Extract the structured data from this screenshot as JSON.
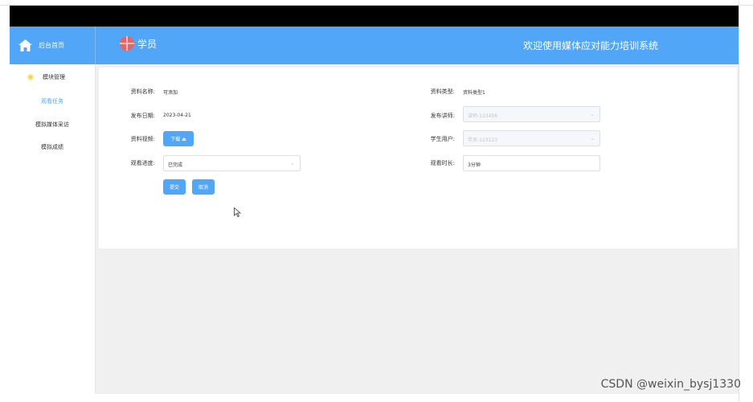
{
  "header": {
    "home_label": "后台首页",
    "role_label": "学员",
    "welcome_text": "欢迎使用媒体应对能力培训系统"
  },
  "sidebar": {
    "group_label": "模块管理",
    "items": [
      {
        "label": "观看任务",
        "active": true
      },
      {
        "label": "模拟媒体采访",
        "active": false
      },
      {
        "label": "模拟成绩",
        "active": false
      }
    ]
  },
  "form": {
    "material_name_label": "资料名称:",
    "material_name_value": "可添加",
    "material_type_label": "资料类型:",
    "material_type_value": "资料类型1",
    "publish_date_label": "发布日期:",
    "publish_date_value": "2023-04-21",
    "lecturer_label": "发布讲师:",
    "lecturer_value": "讲师-123456",
    "video_label": "资料视频:",
    "download_label": "下载 ⏏",
    "student_label": "学生用户:",
    "student_value": "学员-123123",
    "progress_label": "观看进度:",
    "progress_value": "已完成",
    "duration_label": "观看时长:",
    "duration_value": "3分钟",
    "submit_label": "提交",
    "cancel_label": "取消"
  },
  "watermark": "CSDN @weixin_bysj1330",
  "colors": {
    "primary": "#52a6f7",
    "topbar": "#000000",
    "content_bg": "#f0f0f0"
  }
}
